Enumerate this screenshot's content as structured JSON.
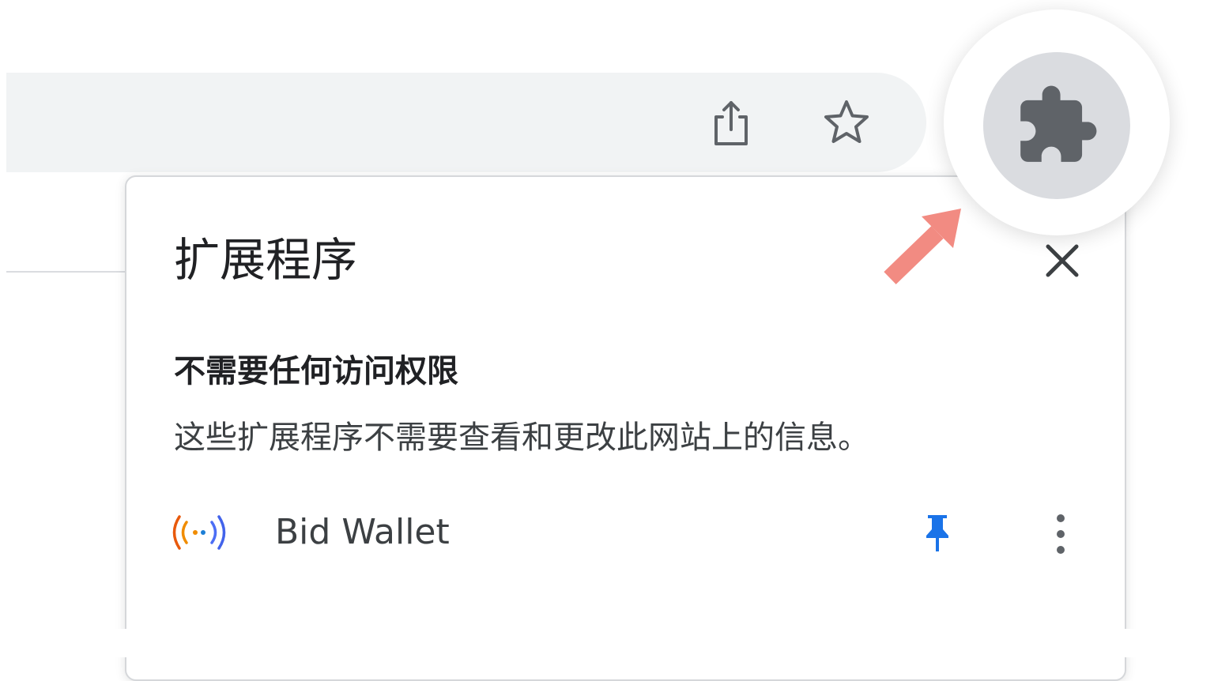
{
  "toolbar": {
    "share_icon": "share-icon",
    "bookmark_icon": "star-icon",
    "extensions_icon": "puzzle-piece-icon"
  },
  "popup": {
    "title": "扩展程序",
    "close_icon": "close-icon",
    "section": {
      "heading": "不需要任何访问权限",
      "description": "这些扩展程序不需要查看和更改此网站上的信息。"
    },
    "extensions": [
      {
        "name": "Bid Wallet",
        "icon": "signal-waves-icon",
        "pinned": true,
        "pin_icon": "pin-icon",
        "menu_icon": "more-vertical-icon"
      }
    ]
  },
  "annotation": {
    "arrow_icon": "arrow-icon",
    "color": "#f28b82"
  },
  "colors": {
    "pin_blue": "#1a73e8",
    "icon_gray": "#5f6368",
    "button_gray": "#dadce0"
  }
}
